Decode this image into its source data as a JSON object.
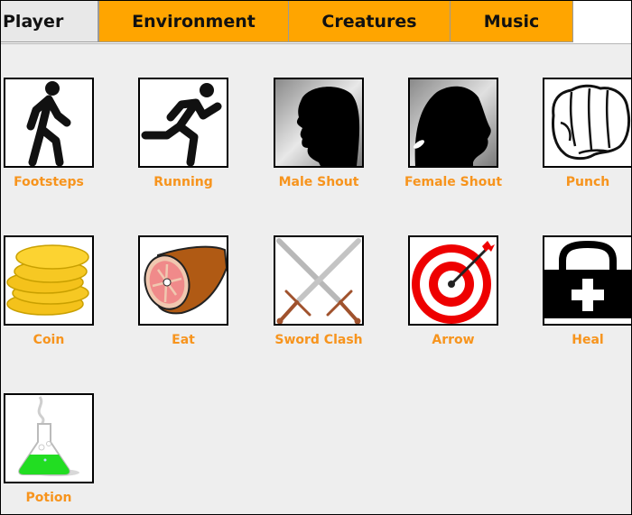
{
  "tabs": [
    {
      "label": "Player",
      "active": true
    },
    {
      "label": "Environment",
      "active": false
    },
    {
      "label": "Creatures",
      "active": false
    },
    {
      "label": "Music",
      "active": false
    }
  ],
  "colors": {
    "tab_inactive": "#ffa500",
    "tab_active": "#e8e8e8",
    "label": "#f7941d",
    "content_bg": "#eeeeee"
  },
  "sounds": [
    {
      "label": "Footsteps",
      "icon": "walking-person-icon"
    },
    {
      "label": "Running",
      "icon": "running-person-icon"
    },
    {
      "label": "Male Shout",
      "icon": "male-shout-silhouette-icon"
    },
    {
      "label": "Female Shout",
      "icon": "female-shout-silhouette-icon"
    },
    {
      "label": "Punch",
      "icon": "fist-icon"
    },
    {
      "label": "Coin",
      "icon": "coin-stack-icon"
    },
    {
      "label": "Eat",
      "icon": "ham-icon"
    },
    {
      "label": "Sword Clash",
      "icon": "crossed-swords-icon"
    },
    {
      "label": "Arrow",
      "icon": "target-arrow-icon"
    },
    {
      "label": "Heal",
      "icon": "medkit-icon"
    },
    {
      "label": "Potion",
      "icon": "potion-flask-icon"
    }
  ]
}
